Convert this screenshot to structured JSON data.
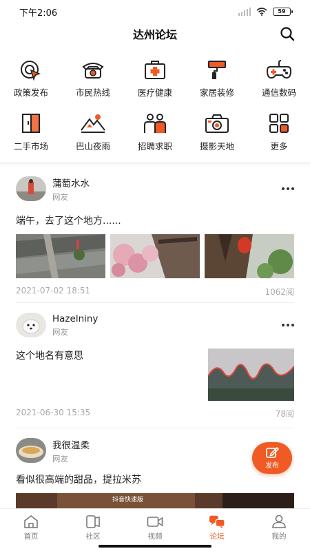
{
  "status_bar": {
    "time": "下午2:06",
    "battery": "59"
  },
  "header": {
    "title": "达州论坛"
  },
  "categories": [
    {
      "label": "政策发布",
      "icon": "policy-target-icon"
    },
    {
      "label": "市民热线",
      "icon": "telephone-icon"
    },
    {
      "label": "医疗健康",
      "icon": "medical-kit-icon"
    },
    {
      "label": "家居装修",
      "icon": "paint-roller-icon"
    },
    {
      "label": "通信数码",
      "icon": "gamepad-icon"
    },
    {
      "label": "二手市场",
      "icon": "wardrobe-icon"
    },
    {
      "label": "巴山夜雨",
      "icon": "mountain-moon-icon"
    },
    {
      "label": "招聘求职",
      "icon": "people-icon"
    },
    {
      "label": "摄影天地",
      "icon": "camera-icon"
    },
    {
      "label": "更多",
      "icon": "grid-more-icon"
    }
  ],
  "posts": [
    {
      "author": "蒲萄水水",
      "role": "网友",
      "text": "端午，去了这个地方......",
      "date": "2021-07-02 18:51",
      "views": "1062阅"
    },
    {
      "author": "Hazelniny",
      "role": "网友",
      "text": "这个地名有意思",
      "date": "2021-06-30 15:35",
      "views": "78阅"
    },
    {
      "author": "我很温柔",
      "role": "网友",
      "text": "看似很高端的甜品，提拉米苏",
      "watermark": "抖音快速版"
    }
  ],
  "fab": {
    "label": "发布"
  },
  "nav": [
    {
      "label": "首页",
      "icon": "home-icon"
    },
    {
      "label": "社区",
      "icon": "community-icon"
    },
    {
      "label": "视频",
      "icon": "video-camera-icon"
    },
    {
      "label": "论坛",
      "icon": "forum-icon",
      "active": true
    },
    {
      "label": "我的",
      "icon": "profile-icon"
    }
  ],
  "colors": {
    "accent": "#f05a24",
    "icon_stroke": "#222222",
    "icon_fill": "#f05a24"
  }
}
